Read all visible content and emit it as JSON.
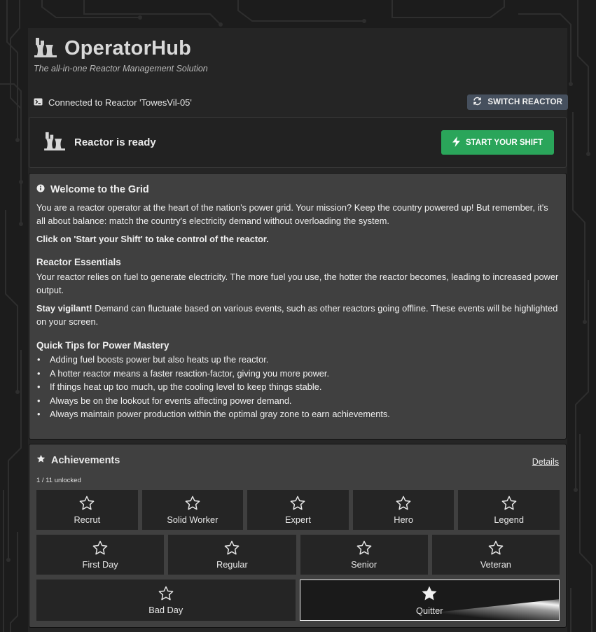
{
  "app": {
    "title": "OperatorHub",
    "tagline": "The all-in-one Reactor Management Solution"
  },
  "connection": {
    "text": "Connected to Reactor 'TowesVil-05'",
    "switch_label": "SWITCH REACTOR"
  },
  "status": {
    "text": "Reactor is ready",
    "start_label": "START YOUR SHIFT"
  },
  "welcome": {
    "title": "Welcome to the Grid",
    "intro": "You are a reactor operator at the heart of the nation's power grid. Your mission? Keep the country powered up! But remember, it's all about balance: match the country's electricity demand without overloading the system.",
    "cta": "Click on 'Start your Shift' to take control of the reactor.",
    "essentials_title": "Reactor Essentials",
    "essentials_text": "Your reactor relies on fuel to generate electricity. The more fuel you use, the hotter the reactor becomes, leading to increased power output.",
    "vigilant_label": "Stay vigilant!",
    "vigilant_text": " Demand can fluctuate based on various events, such as other reactors going offline. These events will be highlighted on your screen.",
    "tips_title": "Quick Tips for Power Mastery",
    "tips": [
      "Adding fuel boosts power but also heats up the reactor.",
      "A hotter reactor means a faster reaction-factor, giving you more power.",
      "If things heat up too much, up the cooling level to keep things stable.",
      "Always be on the lookout for events affecting power demand.",
      "Always maintain power production within the optimal gray zone to earn achievements."
    ]
  },
  "achievements": {
    "title": "Achievements",
    "details_label": "Details",
    "unlocked_text": "1 / 11 unlocked",
    "row1": [
      "Recrut",
      "Solid Worker",
      "Expert",
      "Hero",
      "Legend"
    ],
    "row2": [
      "First Day",
      "Regular",
      "Senior",
      "Veteran"
    ],
    "row3": [
      "Bad Day",
      "Quitter"
    ],
    "unlocked_item": "Quitter"
  }
}
